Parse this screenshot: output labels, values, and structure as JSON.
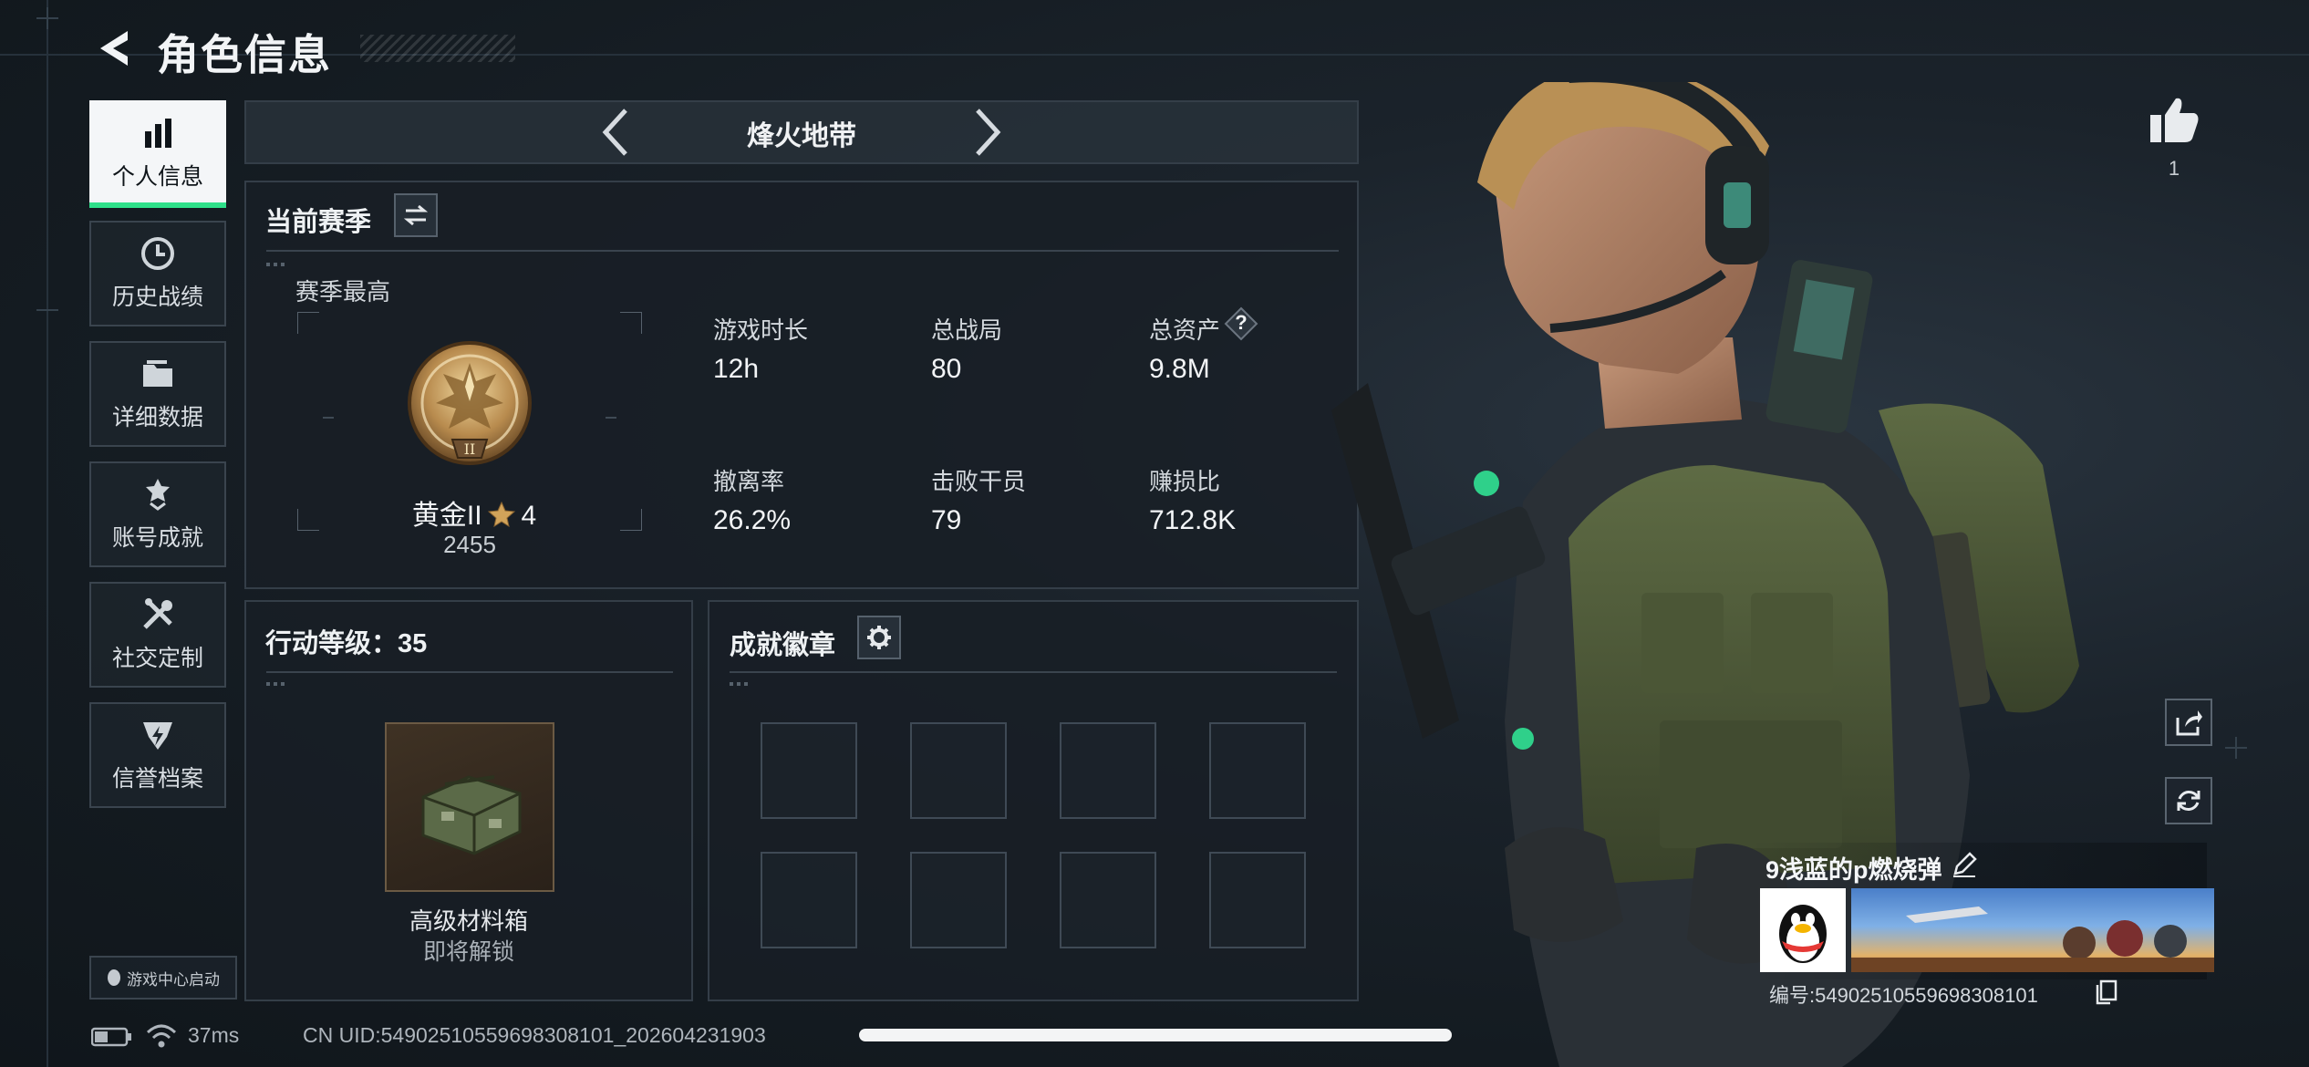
{
  "header": {
    "title": "角色信息"
  },
  "sidebar": {
    "items": [
      {
        "label": "个人信息",
        "icon": "bar-chart-icon",
        "active": true
      },
      {
        "label": "历史战绩",
        "icon": "clock-icon"
      },
      {
        "label": "详细数据",
        "icon": "folder-icon"
      },
      {
        "label": "账号成就",
        "icon": "medal-icon"
      },
      {
        "label": "社交定制",
        "icon": "tools-icon"
      },
      {
        "label": "信誉档案",
        "icon": "shield-bolt-icon"
      }
    ],
    "launch_label": "游戏中心启动"
  },
  "mode": {
    "name": "烽火地带"
  },
  "season": {
    "title": "当前赛季",
    "best_label": "赛季最高",
    "rank_name": "黄金II",
    "rank_stars": "4",
    "rank_score": "2455",
    "rank_badge_numeral": "II",
    "stats": [
      {
        "label": "游戏时长",
        "value": "12h"
      },
      {
        "label": "总战局",
        "value": "80"
      },
      {
        "label": "总资产",
        "value": "9.8M",
        "help": "?"
      },
      {
        "label": "撤离率",
        "value": "26.2%"
      },
      {
        "label": "击败干员",
        "value": "79"
      },
      {
        "label": "赚损比",
        "value": "712.8K"
      }
    ]
  },
  "action_level": {
    "title": "行动等级：35",
    "reward_name": "高级材料箱",
    "reward_status": "即将解锁"
  },
  "achievements": {
    "title": "成就徽章",
    "slot_count": 8
  },
  "profile": {
    "likes": "1",
    "nickname": "9浅蓝的p燃烧弹",
    "id_text": "编号:5490251055969830810​1"
  },
  "status_bar": {
    "ping": "37ms",
    "uid": "CN UID:5490251055969830810​1_202604231903"
  },
  "colors": {
    "accent": "#2fe08a",
    "panel_border": "#343e48",
    "background": "#161d23"
  }
}
